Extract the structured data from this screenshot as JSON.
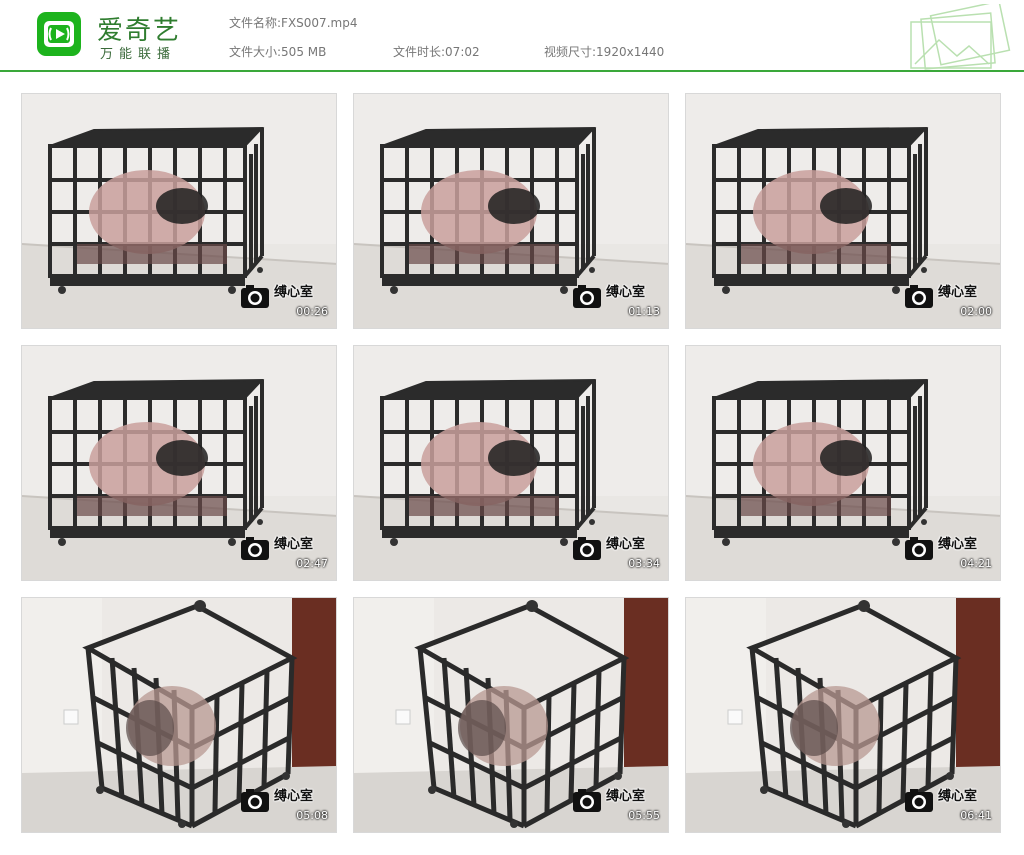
{
  "brand": {
    "name": "爱奇艺",
    "tagline": "万能联播",
    "color": "#1db31d"
  },
  "file_info": {
    "name_label": "文件名称:",
    "name_value": "FXS007.mp4",
    "size_label": "文件大小:",
    "size_value": "505 MB",
    "duration_label": "文件时长:",
    "duration_value": "07:02",
    "resolution_label": "视频尺寸:",
    "resolution_value": "1920x1440"
  },
  "thumbnails": [
    {
      "timestamp": "00:26",
      "watermark": "缚心室",
      "scene": "a"
    },
    {
      "timestamp": "01:13",
      "watermark": "缚心室",
      "scene": "a"
    },
    {
      "timestamp": "02:00",
      "watermark": "缚心室",
      "scene": "a"
    },
    {
      "timestamp": "02:47",
      "watermark": "缚心室",
      "scene": "a"
    },
    {
      "timestamp": "03:34",
      "watermark": "缚心室",
      "scene": "a"
    },
    {
      "timestamp": "04:21",
      "watermark": "缚心室",
      "scene": "a"
    },
    {
      "timestamp": "05:08",
      "watermark": "缚心室",
      "scene": "b"
    },
    {
      "timestamp": "05:55",
      "watermark": "缚心室",
      "scene": "b"
    },
    {
      "timestamp": "06:41",
      "watermark": "缚心室",
      "scene": "b"
    }
  ]
}
